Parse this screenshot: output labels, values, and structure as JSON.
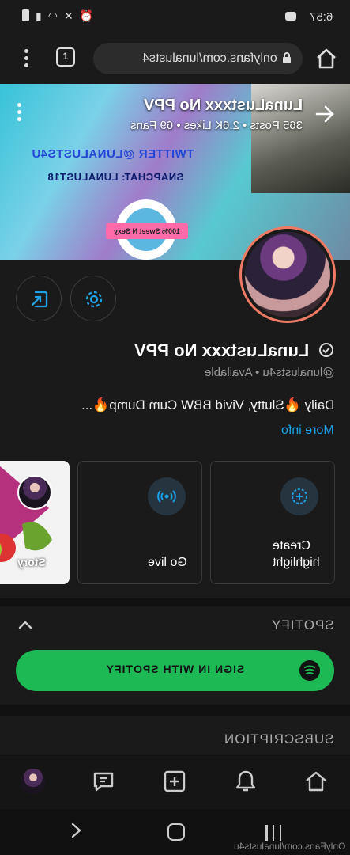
{
  "status_bar": {
    "time": "6:57"
  },
  "browser": {
    "url": "onlyfans.com/lunalusts4",
    "tabs_count": "1"
  },
  "cover": {
    "name": "LunaLustxxx No PPV",
    "stats": "365 Posts  •  2.6K Likes  •  69 Fans",
    "art_lines": [
      "TWITTER @LUNALUSTS4U",
      "SNAPCHAT: LUNALUST18"
    ],
    "banner_text": "100% Sweet N Sexy"
  },
  "profile": {
    "name": "LunaLustxxx No PPV",
    "handle": "@lunalusts4u  •  Available",
    "bio": "Daily 🔥Slutty, Vivid BBW Cum Dump🔥...",
    "more_info": "More info"
  },
  "cards": [
    {
      "label": "Create\nhighlight",
      "icon": "highlight-icon"
    },
    {
      "label": "Go live",
      "icon": "live-icon"
    },
    {
      "label": "Story",
      "icon": "story-thumb"
    }
  ],
  "spotify": {
    "title": "SPOTIFY",
    "button": "SIGN IN WITH SPOTIFY"
  },
  "subscription": {
    "title": "SUBSCRIPTION"
  },
  "system_nav": {
    "url": "OnlyFans.com/lunalusts4u"
  },
  "colors": {
    "accent": "#1da1e8",
    "spotify": "#1db954",
    "avatar_ring": "#f07a63"
  }
}
